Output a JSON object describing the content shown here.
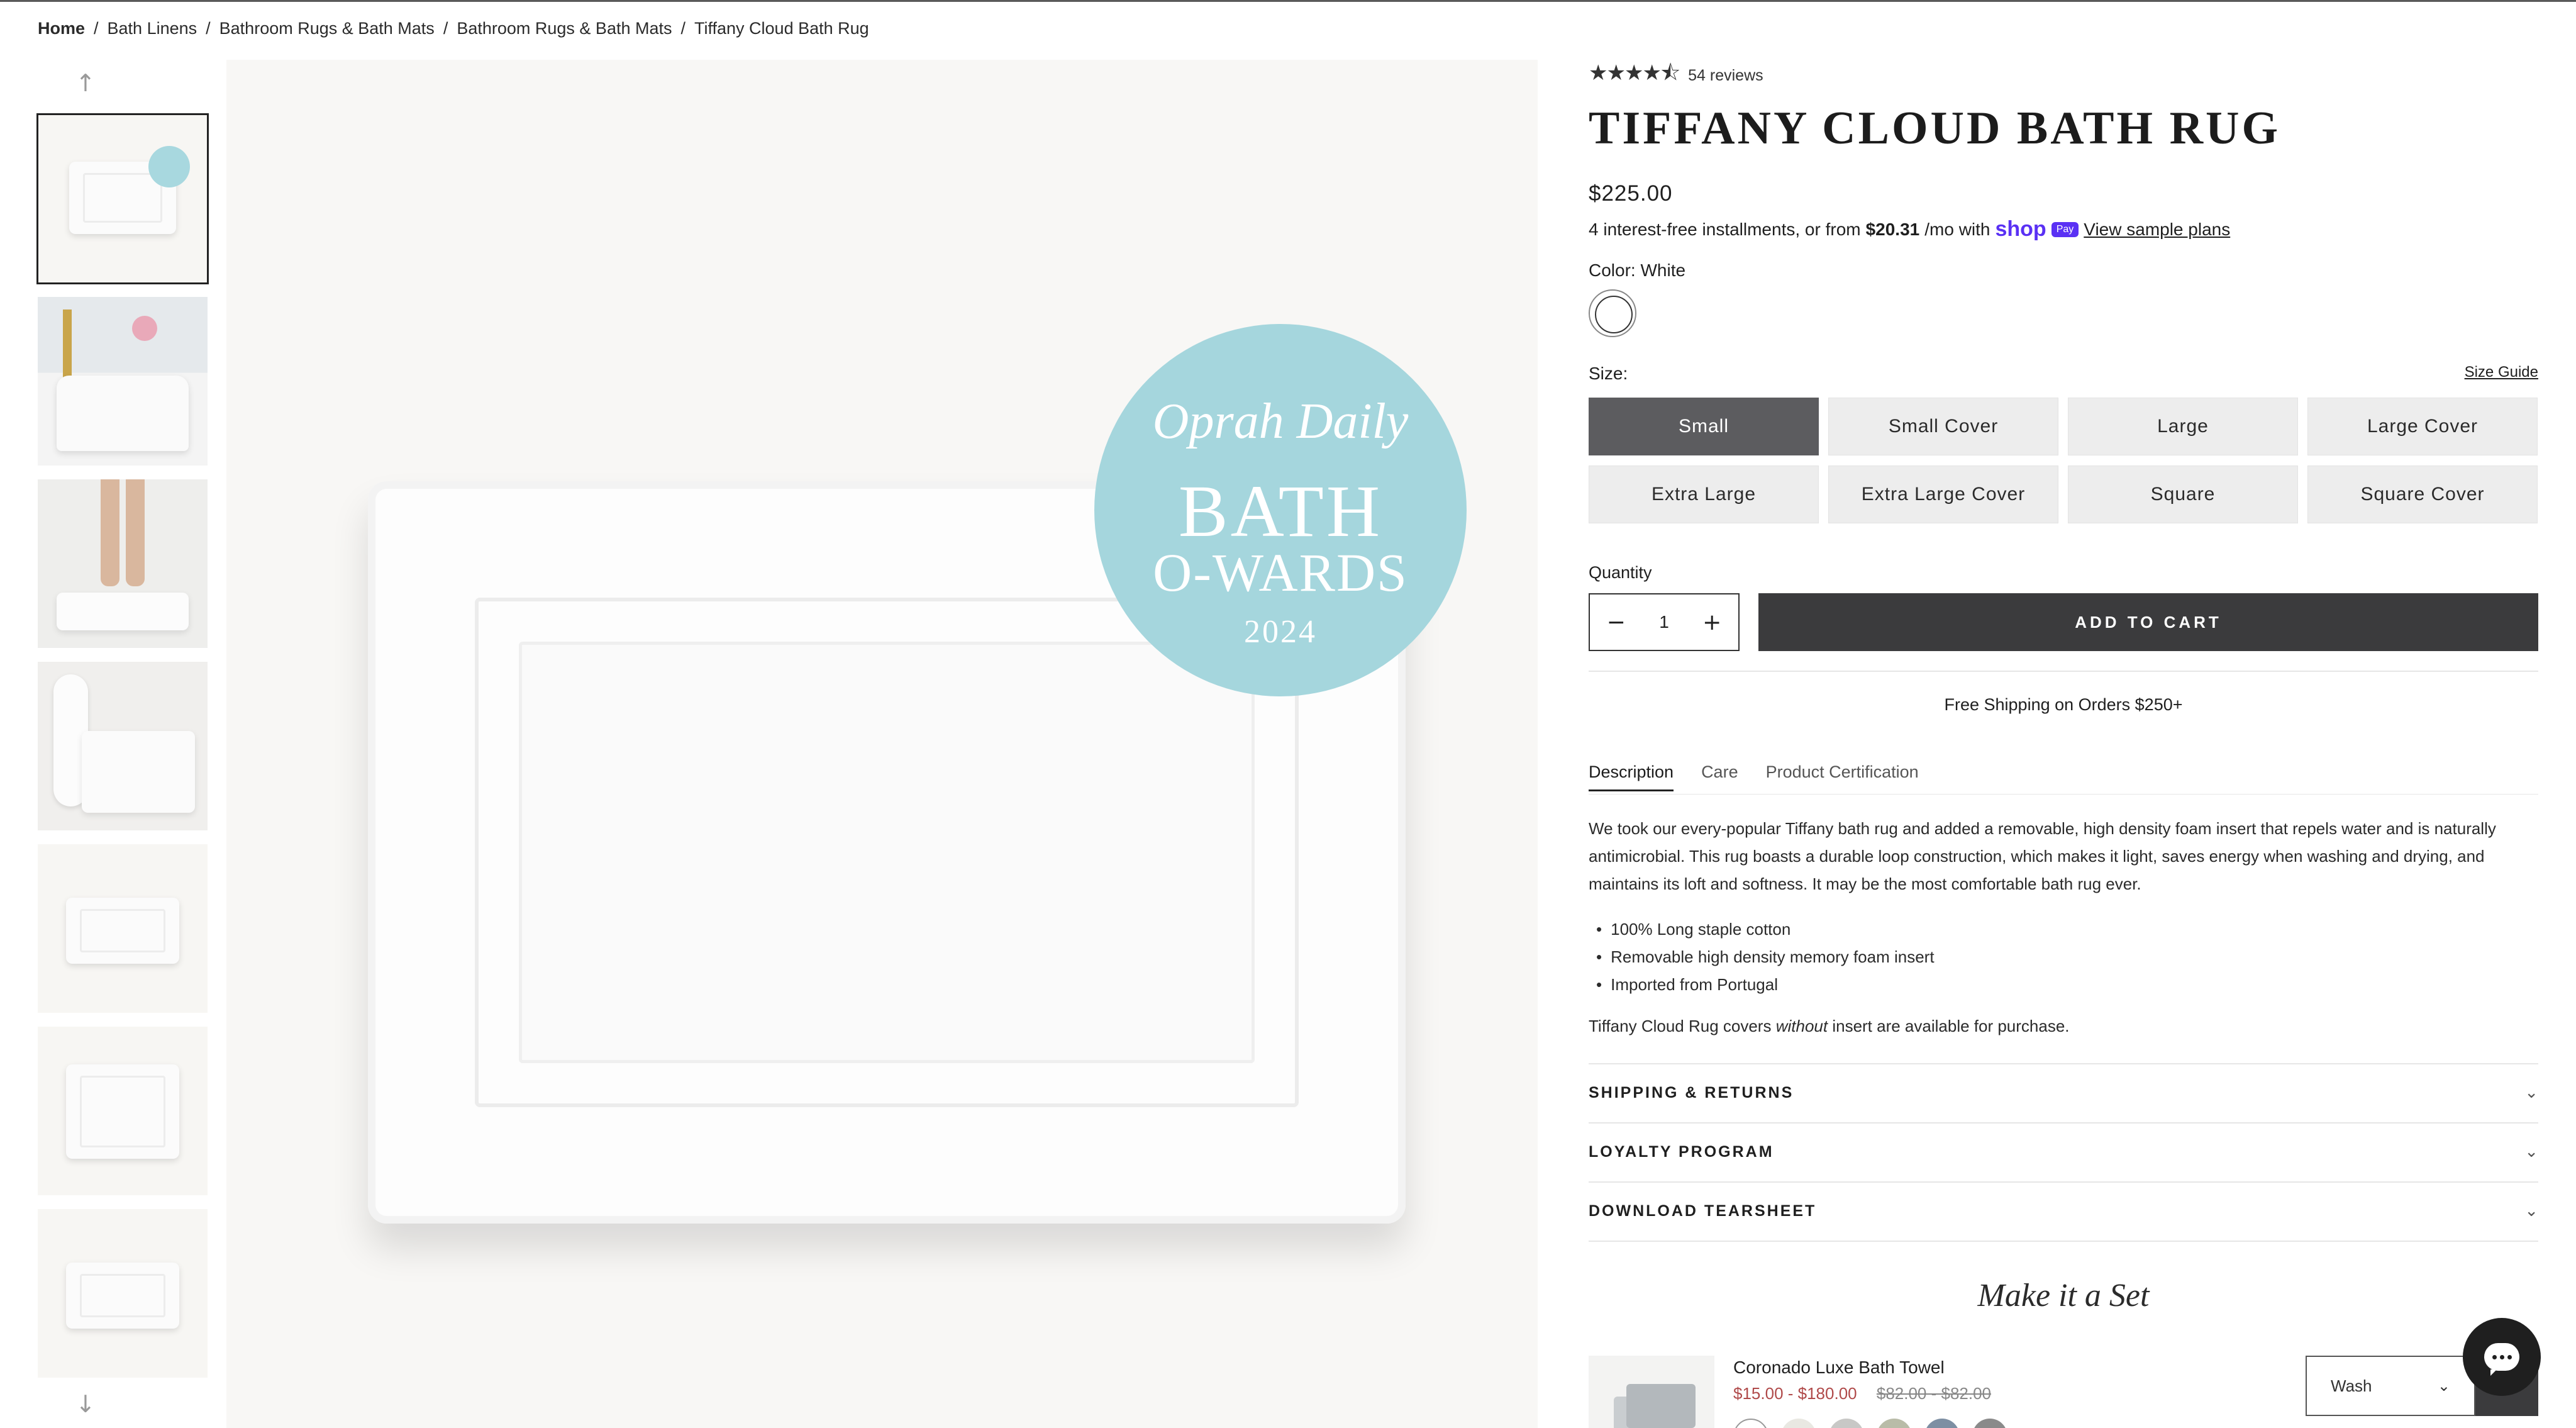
{
  "breadcrumb": {
    "home": "Home",
    "items": [
      "Bath Linens",
      "Bathroom Rugs & Bath Mats",
      "Bathroom Rugs & Bath Mats",
      "Tiffany Cloud Bath Rug"
    ],
    "separator": "/"
  },
  "gallery": {
    "up_icon": "arrow-up-icon",
    "down_icon": "arrow-down-icon",
    "up_glyph": "↑",
    "down_glyph": "↓",
    "thumbnail_count": 7,
    "active_index": 0
  },
  "hero_badge": {
    "line1": "Oprah Daily",
    "line2": "BATH",
    "line3": "O-WARDS",
    "line4": "2024"
  },
  "product": {
    "rating": 4.5,
    "stars": "★★★★⯪",
    "reviews": "54 reviews",
    "title": "TIFFANY CLOUD BATH RUG",
    "price": "$225.00",
    "installments_prefix": "4 interest-free installments, or from",
    "installments_amount": "$20.31",
    "installments_suffix": "/mo with",
    "shop_label": "shop",
    "pay_label": "Pay",
    "sample_plans": "View sample plans",
    "color_label": "Color: White",
    "size_label": "Size:",
    "size_guide": "Size Guide",
    "sizes": [
      "Small",
      "Small Cover",
      "Large",
      "Large Cover",
      "Extra Large",
      "Extra Large Cover",
      "Square",
      "Square Cover"
    ],
    "selected_size": "Small",
    "quantity_label": "Quantity",
    "quantity": "1",
    "minus": "−",
    "plus": "+",
    "add_to_cart": "ADD TO CART",
    "free_shipping": "Free Shipping on Orders $250+"
  },
  "tabs": [
    "Description",
    "Care",
    "Product Certification"
  ],
  "description": {
    "text": "We took our every-popular Tiffany bath rug and added a removable, high density foam insert that repels water and is naturally antimicrobial. This rug boasts a durable loop construction, which makes it light, saves energy when washing and drying, and maintains its loft and softness. It may be the most comfortable bath rug ever.",
    "bullets": [
      "100% Long staple cotton",
      "Removable high density memory foam insert",
      "Imported from Portugal"
    ],
    "note_prefix": "Tiffany Cloud Rug covers",
    "note_italic": "without",
    "note_suffix": "insert are available for purchase."
  },
  "accordions": [
    "SHIPPING & RETURNS",
    "LOYALTY PROGRAM",
    "DOWNLOAD TEARSHEET"
  ],
  "chevron": "⌄",
  "make_set": {
    "heading": "Make it a Set",
    "item_name": "Coronado Luxe Bath Towel",
    "price_range": "$15.00 - $180.00",
    "compare_range": "$82.00 - $82.00",
    "swatch_colors": [
      "#ffffff",
      "#e9e8e2",
      "#c8c8c6",
      "#b9bca8",
      "#7d8fa3",
      "#8a8a8a"
    ],
    "select_value": "Wash"
  },
  "colors": {
    "accent_dark": "#3b3b3d",
    "selected_size_bg": "#5c5c5f",
    "badge": "#a5d6dd",
    "sale_price": "#b04a4a",
    "shop_pay": "#5a31f4"
  }
}
